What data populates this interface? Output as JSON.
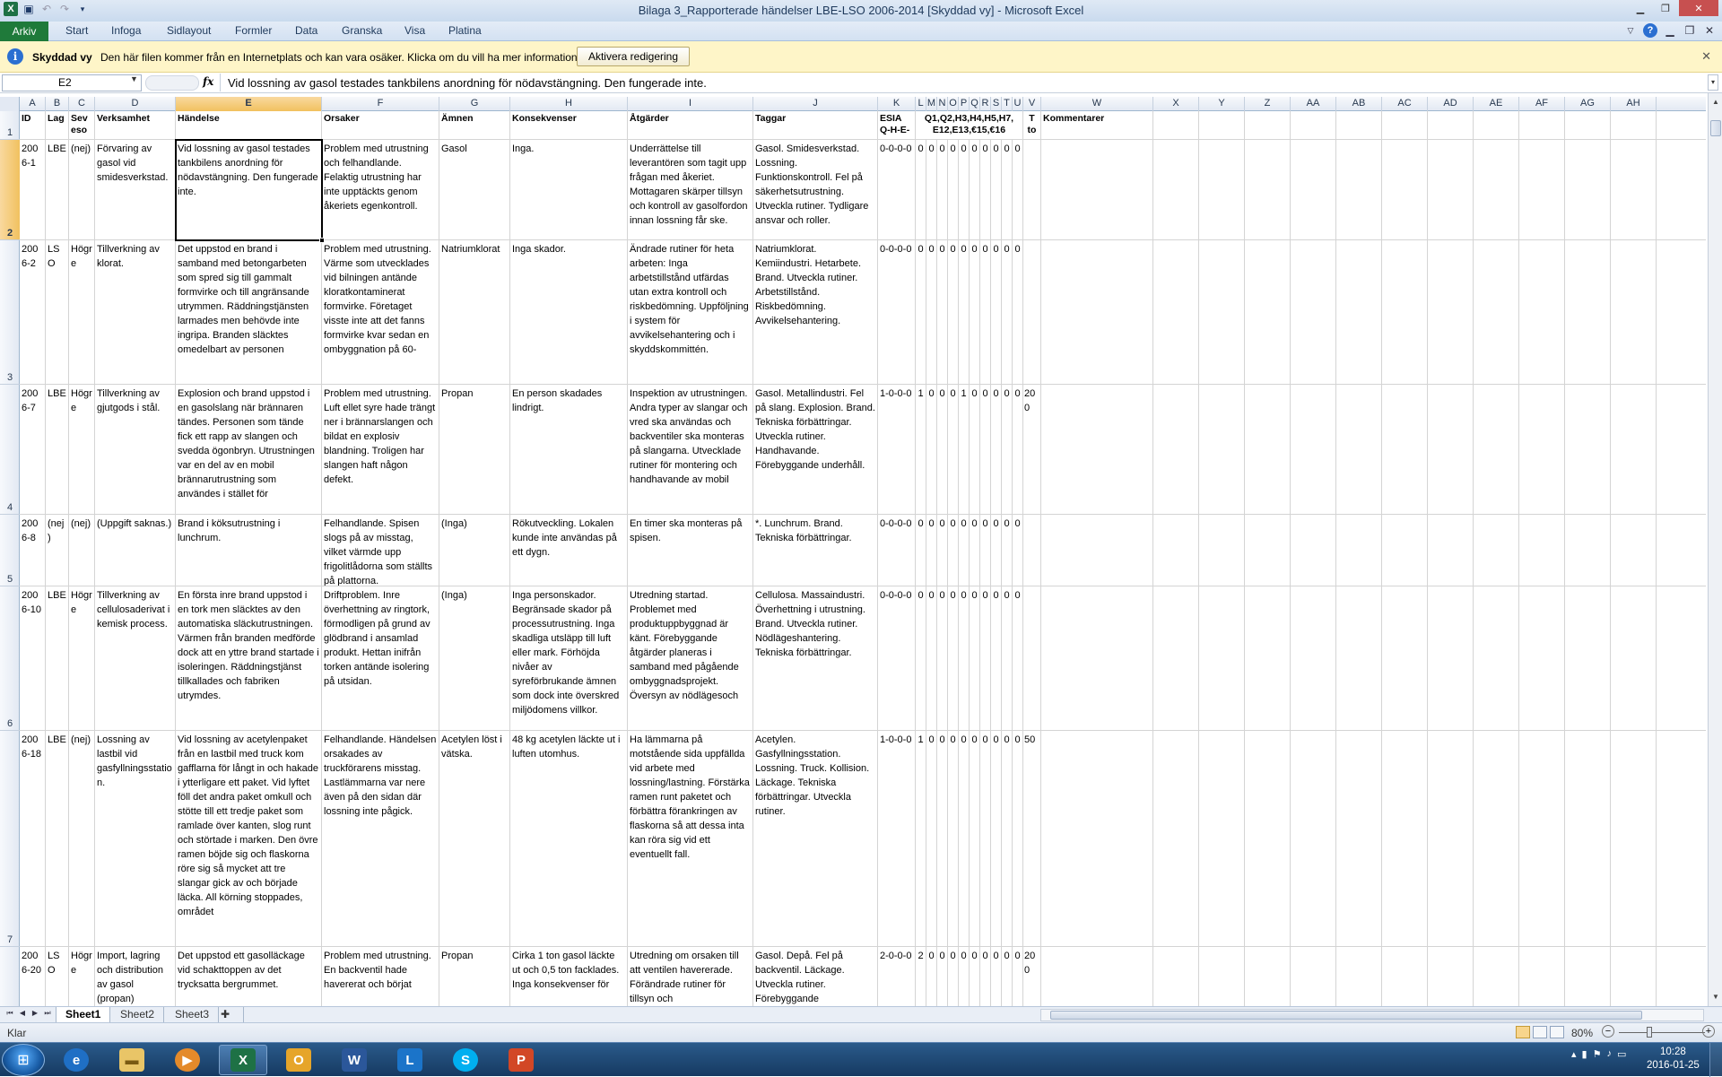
{
  "window": {
    "title": "Bilaga 3_Rapporterade händelser LBE-LSO 2006-2014  [Skyddad vy]  -  Microsoft Excel"
  },
  "ribbon": {
    "file_tab": "Arkiv",
    "tabs": [
      "Start",
      "Infoga",
      "Sidlayout",
      "Formler",
      "Data",
      "Granska",
      "Visa",
      "Platina"
    ]
  },
  "message_bar": {
    "title": "Skyddad vy",
    "text": "Den här filen kommer från en Internetplats och kan vara osäker. Klicka om du vill ha mer information.",
    "button": "Aktivera redigering"
  },
  "formula_bar": {
    "name_box": "E2",
    "fx": "fx",
    "formula": "Vid lossning av gasol testades tankbilens anordning för nödavstängning. Den fungerade inte."
  },
  "columns": [
    "A",
    "B",
    "C",
    "D",
    "E",
    "F",
    "G",
    "H",
    "I",
    "J",
    "K",
    "L",
    "M",
    "N",
    "O",
    "P",
    "Q",
    "R",
    "S",
    "T",
    "U",
    "V",
    "W",
    "X",
    "Y",
    "Z",
    "AA",
    "AB",
    "AC",
    "AD",
    "AE",
    "AF",
    "AG",
    "AH"
  ],
  "row_numbers": [
    "1",
    "2",
    "3",
    "4",
    "5",
    "6",
    "7"
  ],
  "header_row": {
    "A": "ID",
    "B": "Lag",
    "C": "Seveso",
    "D": "Verksamhet",
    "E": "Händelse",
    "F": "Orsaker",
    "G": "Ämnen",
    "H": "Konsekvenser",
    "I": "Åtgärder",
    "J": "Taggar",
    "K": "ESIA Q-H-E-",
    "LU": "Q1,Q2,H3,H4,H5,H7, E12,E13,€15,€16",
    "V": "T ton",
    "W": "Kommentarer"
  },
  "rows": [
    {
      "A": "2006-1",
      "B": "LBE",
      "C": "(nej)",
      "D": "Förvaring av gasol vid smidesverkstad.",
      "E": "Vid lossning av gasol testades tankbilens anordning för nödavstängning. Den fungerade inte.",
      "F": "Problem med utrustning och felhandlande. Felaktig utrustning har inte upptäckts genom åkeriets egenkontroll.",
      "G": "Gasol",
      "H": "Inga.",
      "I": "Underrättelse till leverantören som tagit upp frågan med åkeriet. Mottagaren skärper tillsyn och kontroll av gasolfordon innan lossning får ske.",
      "J": "Gasol. Smidesverkstad. Lossning. Funktionskontroll. Fel på säkerhetsutrustning. Utveckla rutiner. Tydligare ansvar och roller.",
      "K": "0-0-0-0",
      "flags": [
        "0",
        "0",
        "0",
        "0",
        "0",
        "0",
        "0",
        "0",
        "0",
        "0"
      ],
      "V": ""
    },
    {
      "A": "2006-2",
      "B": "LSO",
      "C": "Högre",
      "D": "Tillverkning av klorat.",
      "E": "Det uppstod en brand i samband med betongarbeten som spred sig till gammalt formvirke och till angränsande utrymmen. Räddningstjänsten larmades men behövde inte ingripa. Branden släcktes omedelbart av personen",
      "F": "Problem med utrustning. Värme som utvecklades vid bilningen antände kloratkontaminerat formvirke. Företaget visste inte att det fanns formvirke kvar sedan en ombyggnation på 60-",
      "G": "Natriumklorat",
      "H": "Inga skador.",
      "I": "Ändrade rutiner för heta arbeten: Inga arbetstillstånd utfärdas utan extra kontroll och riskbedömning. Uppföljning i system för avvikelsehantering och i skyddskommittén.",
      "J": "Natriumklorat. Kemiindustri. Hetarbete. Brand. Utveckla rutiner. Arbetstillstånd. Riskbedömning. Avvikelsehantering.",
      "K": "0-0-0-0",
      "flags": [
        "0",
        "0",
        "0",
        "0",
        "0",
        "0",
        "0",
        "0",
        "0",
        "0"
      ],
      "V": ""
    },
    {
      "A": "2006-7",
      "B": "LBE",
      "C": "Högre",
      "D": "Tillverkning av gjutgods i stål.",
      "E": "Explosion och brand uppstod i en gasolslang när brännaren tändes. Personen som tände fick ett rapp av slangen och svedda ögonbryn. Utrustningen var en del av en mobil brännarutrustning som användes i stället för",
      "F": "Problem med utrustning. Luft ellet syre hade trängt ner i brännarslangen och bildat en explosiv blandning. Troligen har slangen haft någon defekt.",
      "G": "Propan",
      "H": "En person skadades lindrigt.",
      "I": "Inspektion av utrustningen. Andra typer av slangar och vred ska användas och backventiler ska monteras på slangarna. Utvecklade rutiner för montering och handhavande av mobil",
      "J": "Gasol. Metallindustri. Fel på slang. Explosion. Brand. Tekniska förbättringar. Utveckla rutiner.  Handhavande. Förebyggande underhåll.",
      "K": "1-0-0-0",
      "flags": [
        "1",
        "0",
        "0",
        "0",
        "1",
        "0",
        "0",
        "0",
        "0",
        "0"
      ],
      "V": "200"
    },
    {
      "A": "2006-8",
      "B": "(nej)",
      "C": "(nej)",
      "D": "(Uppgift saknas.)",
      "E": "Brand i köksutrustning i lunchrum.",
      "F": "Felhandlande. Spisen slogs på av misstag, vilket värmde upp frigolitlådorna som ställts på plattorna.",
      "G": "(Inga)",
      "H": "Rökutveckling. Lokalen kunde inte användas på ett dygn.",
      "I": "En timer ska monteras på spisen.",
      "J": "*. Lunchrum. Brand. Tekniska förbättringar.",
      "K": "0-0-0-0",
      "flags": [
        "0",
        "0",
        "0",
        "0",
        "0",
        "0",
        "0",
        "0",
        "0",
        "0"
      ],
      "V": ""
    },
    {
      "A": "2006-10",
      "B": "LBE",
      "C": "Högre",
      "D": "Tillverkning av cellulosaderivat i kemisk process.",
      "E": "En första inre brand uppstod i en tork men släcktes av den automatiska släckutrustningen. Värmen från branden medförde dock att en yttre brand startade i isoleringen. Räddningstjänst tillkallades och fabriken utrymdes.",
      "F": "Driftproblem. Inre överhettning av ringtork, förmodligen på grund av  glödbrand i ansamlad produkt. Hettan inifrån torken antände isolering på utsidan.",
      "G": "(Inga)",
      "H": "Inga personskador. Begränsade skador på processutrustning. Inga skadliga utsläpp till luft eller mark. Förhöjda nivåer av syreförbrukande ämnen som dock inte överskred miljödomens villkor.",
      "I": "Utredning startad. Problemet med produktuppbyggnad är känt. Förebyggande åtgärder planeras i samband med pågående ombyggnadsprojekt. Översyn av nödlägesoch",
      "J": "Cellulosa. Massaindustri. Överhettning i utrustning. Brand. Utveckla rutiner. Nödlägeshantering. Tekniska förbättringar.",
      "K": "0-0-0-0",
      "flags": [
        "0",
        "0",
        "0",
        "0",
        "0",
        "0",
        "0",
        "0",
        "0",
        "0"
      ],
      "V": ""
    },
    {
      "A": "2006-18",
      "B": "LBE",
      "C": "(nej)",
      "D": "Lossning av lastbil vid gasfyllningsstation.",
      "E": "Vid lossning av acetylenpaket från en lastbil med truck kom gafflarna för långt in och hakade i ytterligare ett paket. Vid lyftet föll det andra paket omkull och stötte till ett tredje paket som ramlade över kanten, slog runt och störtade i marken.  Den övre ramen böjde sig och flaskorna röre sig så mycket att tre slangar gick av och började läcka. All körning stoppades, området",
      "F": "Felhandlande. Händelsen orsakades av truckförarens misstag. Lastlämmarna var nere även på den sidan där lossning inte pågick.",
      "G": "Acetylen löst i vätska.",
      "H": "48 kg acetylen läckte ut i luften utomhus.",
      "I": "Ha lämmarna på motstående sida uppfällda vid arbete med lossning/lastning. Förstärka ramen runt paketet och förbättra förankringen av flaskorna så att dessa inta kan röra sig vid ett eventuellt fall.",
      "J": "Acetylen. Gasfyllningsstation. Lossning. Truck. Kollision. Läckage. Tekniska förbättringar. Utveckla rutiner.",
      "K": "1-0-0-0",
      "flags": [
        "1",
        "0",
        "0",
        "0",
        "0",
        "0",
        "0",
        "0",
        "0",
        "0"
      ],
      "V": "50"
    },
    {
      "A": "2006-20",
      "B": "LSO",
      "C": "Högre",
      "D": "Import, lagring och distribution av gasol (propan)",
      "E": "Det uppstod ett gasolläckage vid schakttoppen av det trycksatta bergrummet.",
      "F": "Problem med utrustning. En backventil hade havererat och börjat",
      "G": "Propan",
      "H": "Cirka 1 ton gasol läckte ut och 0,5 ton facklades. Inga konsekvenser för",
      "I": "Utredning om orsaken till att ventilen havererade. Förändrade rutiner för tillsyn och",
      "J": "Gasol. Depå. Fel på backventil. Läckage. Utveckla rutiner. Förebyggande",
      "K": "2-0-0-0",
      "flags": [
        "2",
        "0",
        "0",
        "0",
        "0",
        "0",
        "0",
        "0",
        "0",
        "0"
      ],
      "V": "200"
    }
  ],
  "sheets": {
    "tabs": [
      "Sheet1",
      "Sheet2",
      "Sheet3"
    ],
    "active": "Sheet1"
  },
  "status": {
    "ready": "Klar",
    "zoom": "80%"
  },
  "taskbar": {
    "time": "10:28",
    "date": "2016-01-25"
  }
}
